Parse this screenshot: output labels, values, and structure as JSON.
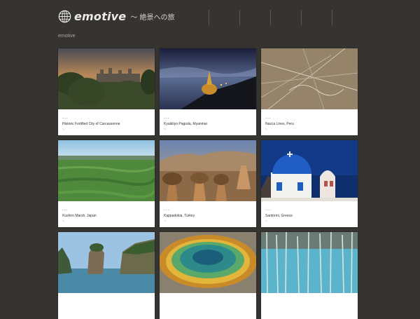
{
  "header": {
    "logo_word": "emotive",
    "tagline": "〜 絶景への旅",
    "nav_count": 5
  },
  "section_label": "emotive",
  "cards": [
    {
      "dots": "...",
      "title": "Historic Fortified City of Carcassonne",
      "meta": "~"
    },
    {
      "dots": "...",
      "title": "Kyaiktiyo Pagoda, Myanmar",
      "meta": "~"
    },
    {
      "dots": "...",
      "title": "Nazca Lines, Peru",
      "meta": "~"
    },
    {
      "dots": "...",
      "title": "Kushiro Marsh, Japan",
      "meta": "~"
    },
    {
      "dots": "...",
      "title": "Kappadokia, Turkey",
      "meta": "~"
    },
    {
      "dots": "...",
      "title": "Santorini, Greece",
      "meta": "~"
    },
    {
      "dots": "",
      "title": "",
      "meta": ""
    },
    {
      "dots": "",
      "title": "",
      "meta": ""
    },
    {
      "dots": "",
      "title": "",
      "meta": ""
    }
  ],
  "colors": {
    "background": "#363430",
    "card": "#ffffff",
    "text": "#333333"
  }
}
